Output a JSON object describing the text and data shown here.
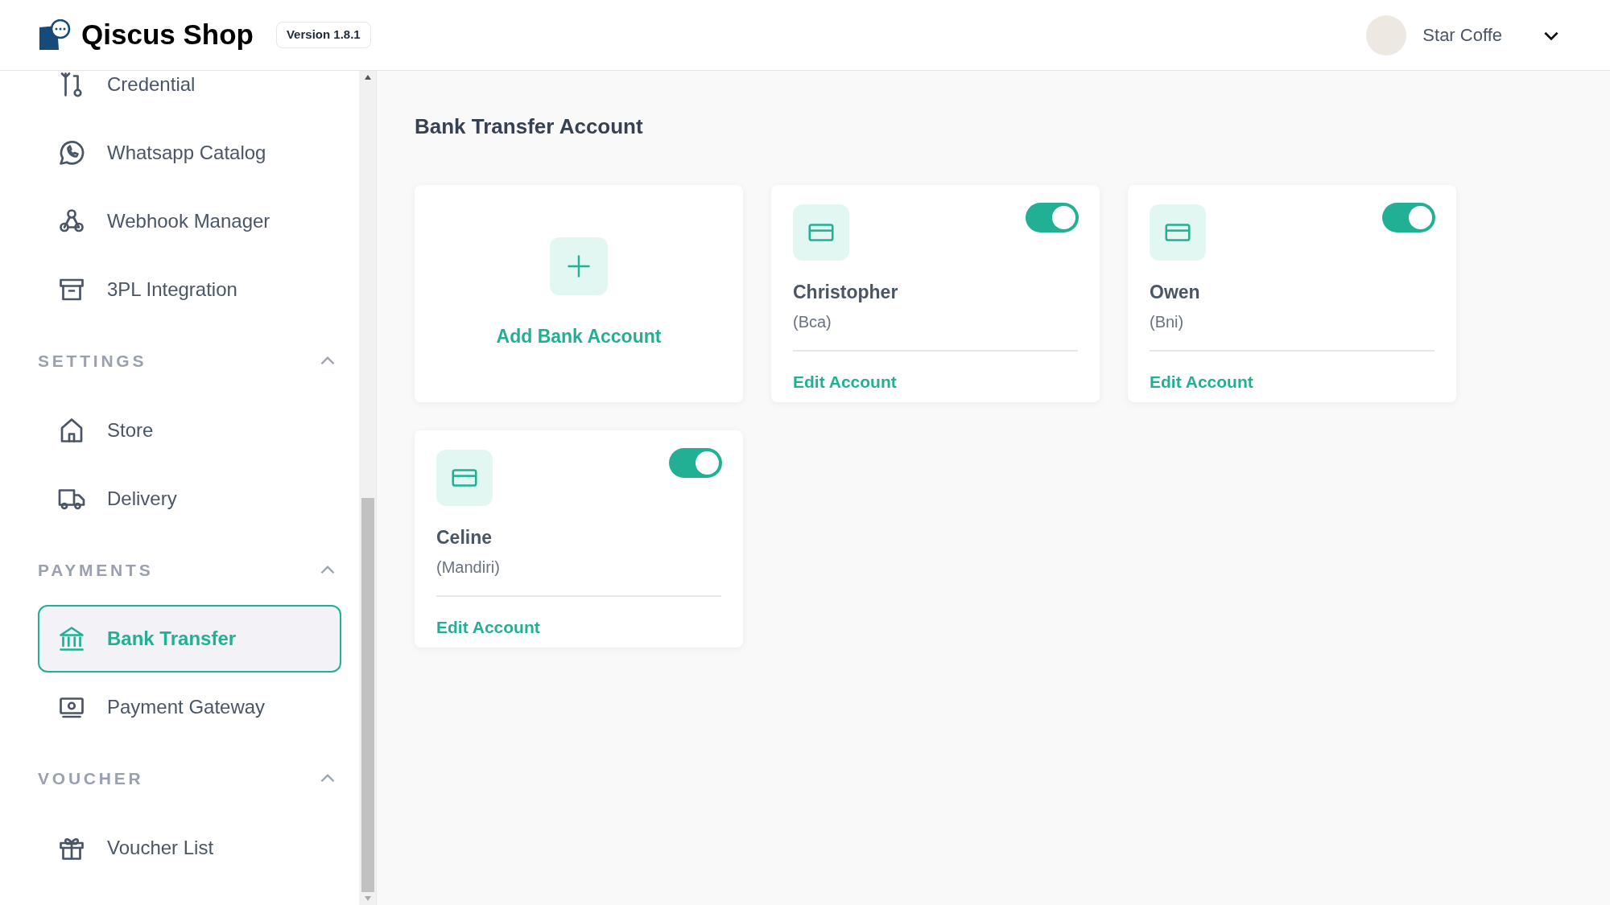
{
  "header": {
    "brand": "Qiscus Shop",
    "version": "Version 1.8.1",
    "user": {
      "name": "Star Coffe"
    }
  },
  "sidebar": {
    "items": [
      {
        "label": "Credential",
        "selected": false
      },
      {
        "label": "Whatsapp Catalog",
        "selected": false
      },
      {
        "label": "Webhook Manager",
        "selected": false
      },
      {
        "label": "3PL Integration",
        "selected": false
      }
    ],
    "sections": [
      {
        "title": "SETTINGS",
        "expanded": true,
        "items": [
          {
            "label": "Store",
            "selected": false
          },
          {
            "label": "Delivery",
            "selected": false
          }
        ]
      },
      {
        "title": "PAYMENTS",
        "expanded": true,
        "items": [
          {
            "label": "Bank Transfer",
            "selected": true
          },
          {
            "label": "Payment Gateway",
            "selected": false
          }
        ]
      },
      {
        "title": "VOUCHER",
        "expanded": true,
        "items": [
          {
            "label": "Voucher List",
            "selected": false
          }
        ]
      }
    ]
  },
  "main": {
    "title": "Bank Transfer Account",
    "add_card": {
      "label": "Add Bank Account"
    },
    "accounts": [
      {
        "name": "Christopher",
        "bank": "(Bca)",
        "on": true,
        "action": "Edit Account"
      },
      {
        "name": "Owen",
        "bank": "(Bni)",
        "on": true,
        "action": "Edit Account"
      },
      {
        "name": "Celine",
        "bank": "(Mandiri)",
        "on": true,
        "action": "Edit Account"
      }
    ]
  }
}
